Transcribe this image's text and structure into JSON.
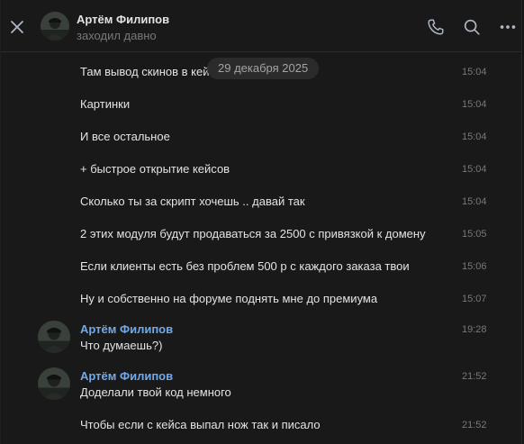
{
  "header": {
    "name": "Артём Филипов",
    "status": "заходил давно"
  },
  "date_divider": "29 декабря 2025",
  "messages": [
    {
      "text": "Там вывод скинов в кейс",
      "time": "15:04"
    },
    {
      "text": "Картинки",
      "time": "15:04"
    },
    {
      "text": "И все остальное",
      "time": "15:04"
    },
    {
      "text": "+ быстрое открытие кейсов",
      "time": "15:04"
    },
    {
      "text": "Сколько ты за скрипт хочешь .. давай так",
      "time": "15:04"
    },
    {
      "text": "2 этих модуля будут продаваться за 2500 с привязкой к домену",
      "time": "15:05"
    },
    {
      "text": "Если клиенты есть без проблем 500 р с каждого заказа твои",
      "time": "15:06"
    },
    {
      "text": "Ну и собственно на форуме поднять мне до премиума",
      "time": "15:07"
    },
    {
      "author": "Артём Филипов",
      "text": "Что думаешь?)",
      "time": "19:28"
    },
    {
      "author": "Артём Филипов",
      "text": "Доделали твой код немного",
      "time": "21:52"
    },
    {
      "text": "Чтобы если с кейса выпал нож так и писало",
      "time": "21:52"
    }
  ],
  "icons": {
    "close": "close-icon",
    "call": "phone-icon",
    "search": "search-icon",
    "more": "more-icon"
  },
  "colors": {
    "background": "#191919",
    "text": "#e1e3e6",
    "secondary": "#76787a",
    "author": "#71aaeb"
  }
}
